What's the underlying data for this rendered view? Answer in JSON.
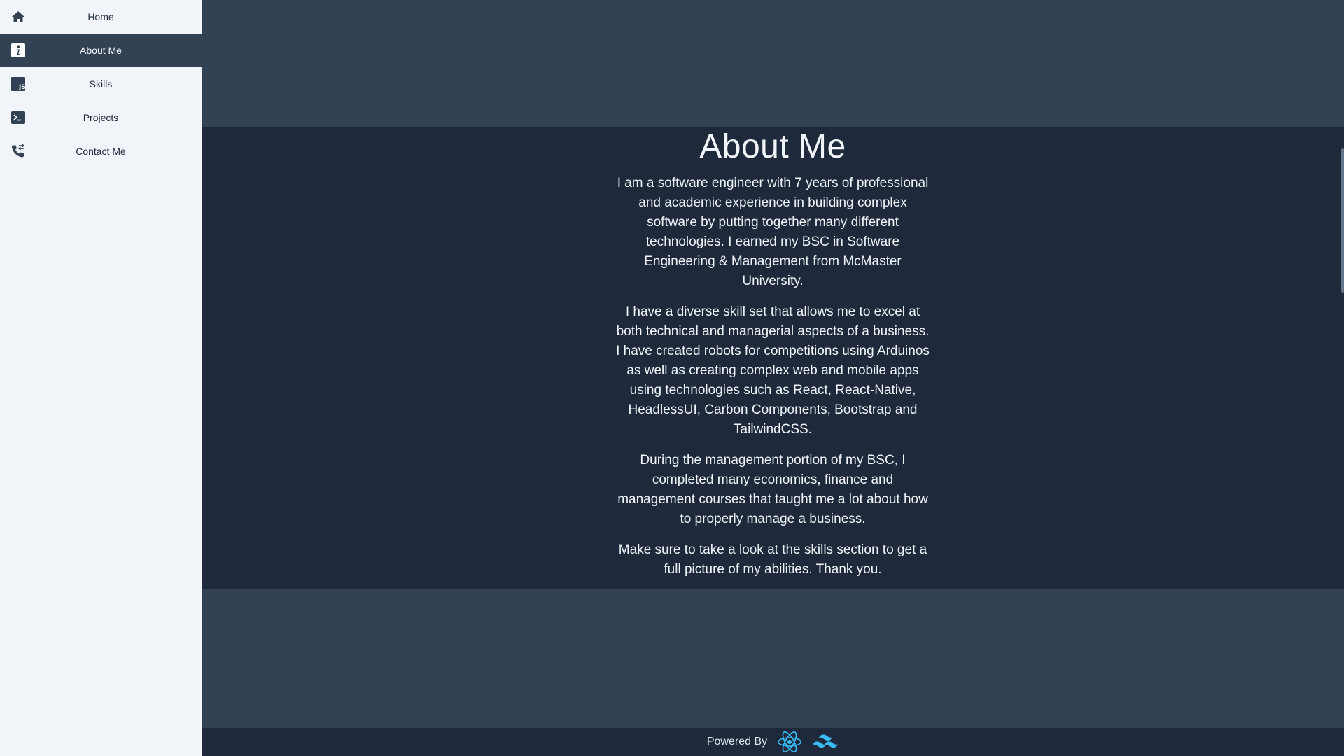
{
  "sidebar": {
    "items": [
      {
        "label": "Home",
        "icon": "home-icon"
      },
      {
        "label": "About Me",
        "icon": "info-icon",
        "active": true
      },
      {
        "label": "Skills",
        "icon": "js-icon"
      },
      {
        "label": "Projects",
        "icon": "terminal-icon"
      },
      {
        "label": "Contact Me",
        "icon": "phone-icon"
      }
    ]
  },
  "about": {
    "title": "About Me",
    "paragraphs": [
      "I am a software engineer with 7 years of professional and academic experience in building complex software by putting together many different technologies. I earned my BSC in Software Engineering & Management from McMaster University.",
      "I have a diverse skill set that allows me to excel at both technical and managerial aspects of a business. I have created robots for competitions using Arduinos as well as creating complex web and mobile apps using technologies such as React, React-Native, HeadlessUI, Carbon Components, Bootstrap and TailwindCSS.",
      "During the management portion of my BSC, I completed many economics, finance and management courses that taught me a lot about how to properly manage a business.",
      "Make sure to take a look at the skills section to get a full picture of my abilities. Thank you."
    ]
  },
  "footer": {
    "powered_by": "Powered By",
    "logos": [
      "react-logo-icon",
      "tailwind-logo-icon"
    ]
  },
  "colors": {
    "sidebar_bg": "#f1f5f9",
    "active_bg": "#334155",
    "main_bg": "#334155",
    "section_bg": "#1e293b",
    "accent": "#38bdf8"
  }
}
